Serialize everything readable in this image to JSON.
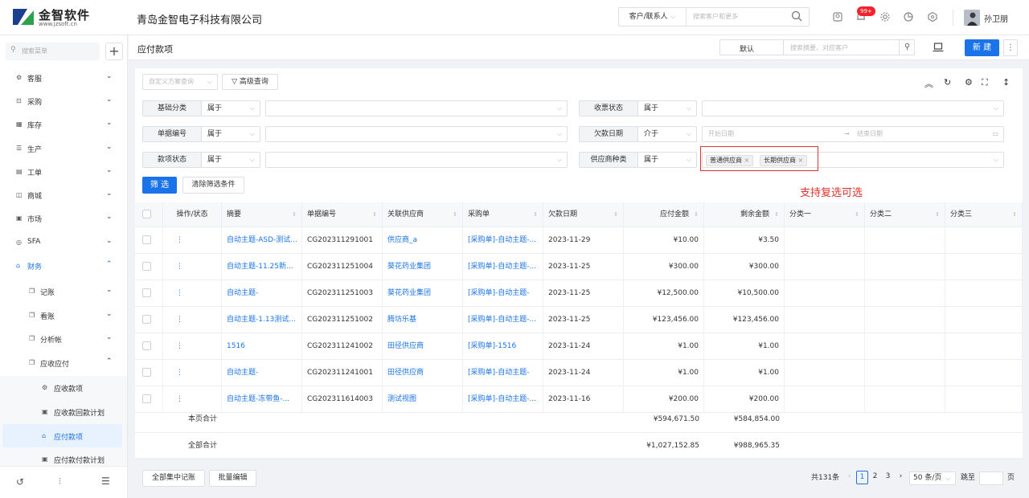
{
  "header": {
    "logo_text": "金智软件",
    "logo_url": "www.jzsoft.cn",
    "company": "青岛金智电子科技有限公司",
    "search_type": "客户/联系人",
    "search_placeholder": "搜索客户和更多",
    "notif_badge": "99+",
    "username": "孙卫朋"
  },
  "sidebar": {
    "search_placeholder": "搜索菜单",
    "plus": "+",
    "items": [
      {
        "label": "客服",
        "icon": "⚙"
      },
      {
        "label": "采购",
        "icon": "⊡"
      },
      {
        "label": "库存",
        "icon": "▦"
      },
      {
        "label": "生产",
        "icon": "☰"
      },
      {
        "label": "工单",
        "icon": "▤"
      },
      {
        "label": "商城",
        "icon": "◫"
      },
      {
        "label": "市场",
        "icon": "▣"
      },
      {
        "label": "SFA",
        "icon": "◎"
      },
      {
        "label": "财务",
        "icon": "⌂"
      },
      {
        "label": "记账",
        "icon": "❐"
      },
      {
        "label": "看账",
        "icon": "❐"
      },
      {
        "label": "分析帐",
        "icon": "❐"
      },
      {
        "label": "应收应付",
        "icon": "❐"
      },
      {
        "label": "应收款项",
        "icon": "⚙"
      },
      {
        "label": "应收款回款计划",
        "icon": "▣"
      },
      {
        "label": "应付款项",
        "icon": "⌂"
      },
      {
        "label": "应付款付款计划",
        "icon": "▣"
      }
    ]
  },
  "page": {
    "title": "应付款项",
    "view_select": "默认",
    "search_placeholder": "搜索摘要、对应客户",
    "new_button": "新 建",
    "more_button": "⋮"
  },
  "toolbar": {
    "custom_query_placeholder": "自定义方案查询",
    "advanced_query": "高级查询"
  },
  "filters": {
    "rows": [
      {
        "label": "基础分类",
        "op": "属于",
        "value": ""
      },
      {
        "label": "单据编号",
        "op": "属于",
        "value": ""
      },
      {
        "label": "款项状态",
        "op": "属于",
        "value": ""
      }
    ],
    "right_rows": [
      {
        "label": "收票状态",
        "op": "属于"
      },
      {
        "label": "欠款日期",
        "op": "介于",
        "start_placeholder": "开始日期",
        "end_placeholder": "结束日期"
      },
      {
        "label": "供应商种类",
        "op": "属于",
        "tags": [
          "普通供应商",
          "长期供应商"
        ]
      }
    ],
    "filter_button": "筛 选",
    "clear_button": "清除筛选条件",
    "annotation": "支持复选可选"
  },
  "table": {
    "columns": [
      "操作/状态",
      "摘要",
      "单据编号",
      "关联供应商",
      "采购单",
      "欠款日期",
      "应付金额",
      "剩余金额",
      "分类一",
      "分类二",
      "分类三"
    ],
    "rows": [
      {
        "action": "⋮",
        "summary": "自动主题-ASD-测试...",
        "code": "CG202311291001",
        "supplier": "供应商_a",
        "po": "[采购单]-自动主题-...",
        "date": "2023-11-29",
        "amount": "¥10.00",
        "remain": "¥3.50"
      },
      {
        "action": "⋮",
        "summary": "自动主题-11.25新...",
        "code": "CG202311251004",
        "supplier": "葵花药业集团",
        "po": "[采购单]-自动主题-...",
        "date": "2023-11-25",
        "amount": "¥300.00",
        "remain": "¥300.00"
      },
      {
        "action": "⋮",
        "summary": "自动主题-",
        "code": "CG202311251003",
        "supplier": "葵花药业集团",
        "po": "[采购单]-自动主题-",
        "date": "2023-11-25",
        "amount": "¥12,500.00",
        "remain": "¥10,500.00"
      },
      {
        "action": "⋮",
        "summary": "自动主题-1.13测试...",
        "code": "CG202311251002",
        "supplier": "腾坊乐基",
        "po": "[采购单]-自动主题-...",
        "date": "2023-11-25",
        "amount": "¥123,456.00",
        "remain": "¥123,456.00"
      },
      {
        "action": "⋮",
        "summary": "1516",
        "code": "CG202311241002",
        "supplier": "田径供应商",
        "po": "[采购单]-1516",
        "date": "2023-11-24",
        "amount": "¥1.00",
        "remain": "¥1.00"
      },
      {
        "action": "⋮",
        "summary": "自动主题-",
        "code": "CG202311241001",
        "supplier": "田径供应商",
        "po": "[采购单]-自动主题-",
        "date": "2023-11-24",
        "amount": "¥1.00",
        "remain": "¥1.00"
      },
      {
        "action": "⋮",
        "summary": "自动主题-冻带鱼-...",
        "code": "CG202311614003",
        "supplier": "测试视图",
        "po": "[采购单]-自动主题-...",
        "date": "2023-11-16",
        "amount": "¥200.00",
        "remain": "¥200.00"
      }
    ],
    "page_total_label": "本页合计",
    "page_total_amount": "¥594,671.50",
    "page_total_remain": "¥584,854.00",
    "all_total_label": "全部合计",
    "all_total_amount": "¥1,027,152.85",
    "all_total_remain": "¥988,965.35"
  },
  "footer": {
    "btn_all_ledger": "全部集中记账",
    "btn_batch_edit": "批量编辑",
    "total": "共131条",
    "pages": [
      "1",
      "2",
      "3"
    ],
    "page_size": "50 条/页",
    "goto": "跳至",
    "page_unit": "页"
  },
  "colors": {
    "accent": "#1a73e8",
    "annotation": "#e0312b"
  }
}
